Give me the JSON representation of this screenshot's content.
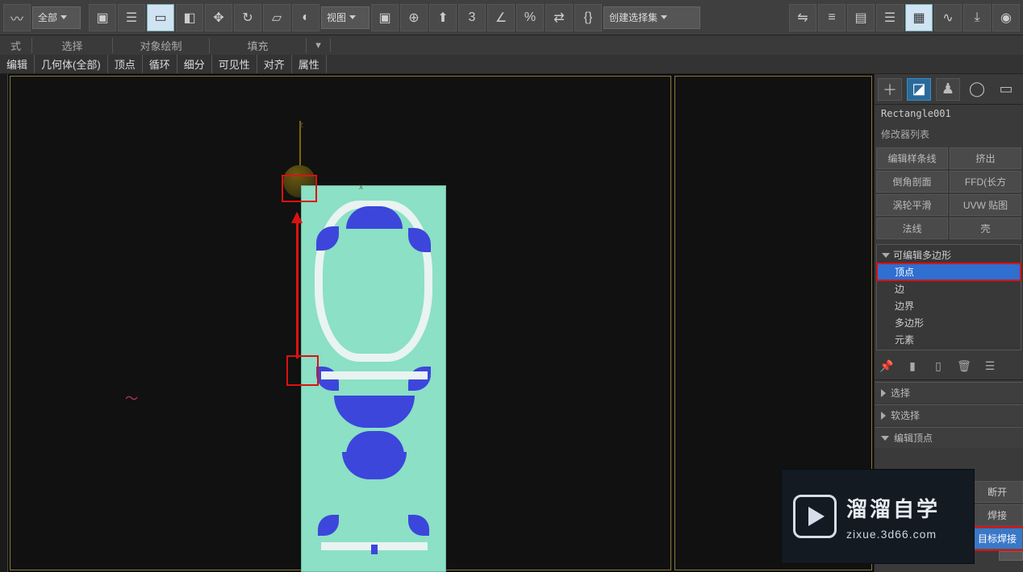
{
  "toolbar": {
    "dropdown_all": "全部",
    "dropdown_view": "视图",
    "dropdown_create_selset": "创建选择集",
    "percent_icon": "%",
    "three_icon": "3",
    "angle_icon": "∠"
  },
  "second_row": {
    "style": "式",
    "select": "选择",
    "object_paint": "对象绘制",
    "fill": "填充"
  },
  "tabs": [
    "编辑",
    "几何体(全部)",
    "顶点",
    "循环",
    "细分",
    "可见性",
    "对齐",
    "属性"
  ],
  "object_name": "Rectangle001",
  "modifier_list_label": "修改器列表",
  "modifier_buttons": [
    [
      "编辑样条线",
      "挤出"
    ],
    [
      "倒角剖面",
      "FFD(长方"
    ],
    [
      "涡轮平滑",
      "UVW 贴图"
    ],
    [
      "法线",
      "壳"
    ]
  ],
  "stack": {
    "root": "可编辑多边形",
    "items": [
      "顶点",
      "边",
      "边界",
      "多边形",
      "元素"
    ],
    "selected_index": 0
  },
  "rollouts": [
    "选择",
    "软选择",
    "编辑顶点"
  ],
  "float_buttons": [
    "断开",
    "焊接",
    "目标焊接"
  ],
  "float_highlight_index": 2,
  "axes": {
    "z": "z",
    "x": "x"
  },
  "watermark": {
    "cn": "溜溜自学",
    "url": "zixue.3d66.com"
  }
}
